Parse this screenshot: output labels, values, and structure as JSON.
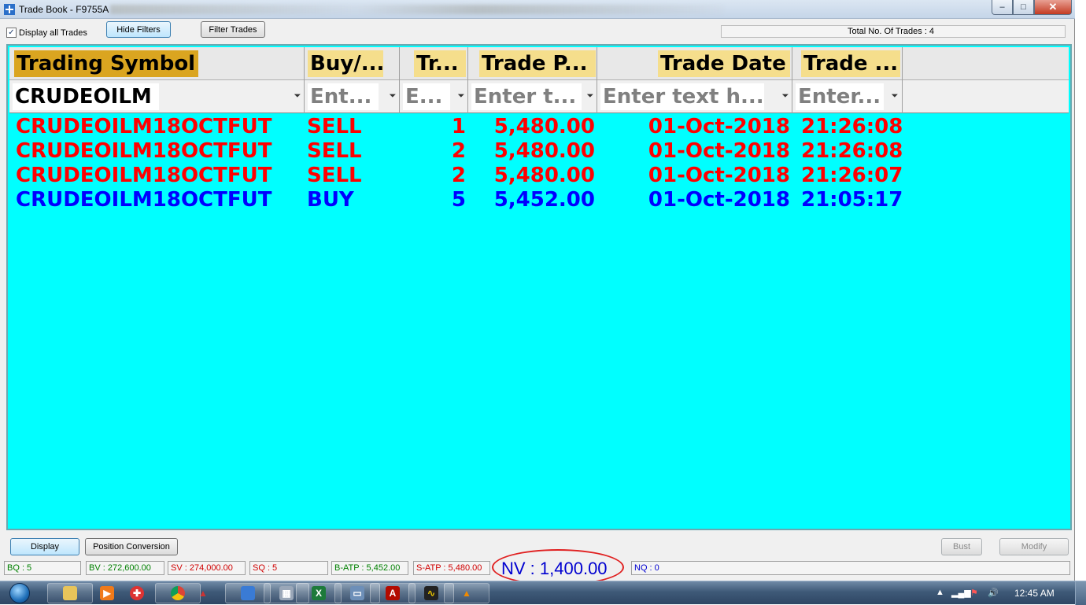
{
  "window": {
    "title": "Trade Book - F9755A",
    "minimize_glyph": "–",
    "maximize_glyph": "□",
    "close_glyph": "✕"
  },
  "toolbar": {
    "display_all_label": "Display all Trades",
    "display_all_checked": true,
    "hide_filters_label": "Hide Filters",
    "filter_trades_label": "Filter Trades",
    "total_trades": "Total No. Of Trades : 4"
  },
  "grid": {
    "columns": [
      {
        "header": "Trading Symbol",
        "filter_value": "CRUDEOILM",
        "filter_placeholder": ""
      },
      {
        "header": "Buy/...",
        "filter_value": "",
        "filter_placeholder": "Ent..."
      },
      {
        "header": "Tr...",
        "filter_value": "",
        "filter_placeholder": "E..."
      },
      {
        "header": "Trade P...",
        "filter_value": "",
        "filter_placeholder": "Enter t..."
      },
      {
        "header": "Trade Date",
        "filter_value": "",
        "filter_placeholder": "Enter text h..."
      },
      {
        "header": "Trade ...",
        "filter_value": "",
        "filter_placeholder": "Enter..."
      }
    ],
    "rows": [
      {
        "symbol": "CRUDEOILM18OCTFUT",
        "side": "SELL",
        "qty": "1",
        "price": "5,480.00",
        "date": "01-Oct-2018",
        "time": "21:26:08"
      },
      {
        "symbol": "CRUDEOILM18OCTFUT",
        "side": "SELL",
        "qty": "2",
        "price": "5,480.00",
        "date": "01-Oct-2018",
        "time": "21:26:08"
      },
      {
        "symbol": "CRUDEOILM18OCTFUT",
        "side": "SELL",
        "qty": "2",
        "price": "5,480.00",
        "date": "01-Oct-2018",
        "time": "21:26:07"
      },
      {
        "symbol": "CRUDEOILM18OCTFUT",
        "side": "BUY",
        "qty": "5",
        "price": "5,452.00",
        "date": "01-Oct-2018",
        "time": "21:05:17"
      }
    ],
    "colors": {
      "background": "#00ffff",
      "sell": "#ff0000",
      "buy": "#0000ff",
      "symbol_header": "#daa520",
      "header": "#f5de8c"
    }
  },
  "actions": {
    "display_label": "Display",
    "position_conversion_label": "Position Conversion",
    "bust_label": "Bust",
    "modify_label": "Modify"
  },
  "status": {
    "bq": "BQ : 5",
    "bv": "BV : 272,600.00",
    "sv": "SV : 274,000.00",
    "sq": "SQ : 5",
    "b_atp": "B-ATP : 5,452.00",
    "s_atp": "S-ATP : 5,480.00",
    "nv": "NV : 1,400.00",
    "nq": "NQ : 0"
  },
  "taskbar": {
    "apps": [
      "file-explorer-icon",
      "media-player-icon",
      "network-icon",
      "chrome-icon",
      "app-triangle-icon",
      "app-blue-icon",
      "calculator-icon",
      "excel-icon",
      "window-app-icon",
      "pdf-icon",
      "terminal-app-icon",
      "vlc-icon"
    ],
    "clock": "12:45 AM"
  }
}
